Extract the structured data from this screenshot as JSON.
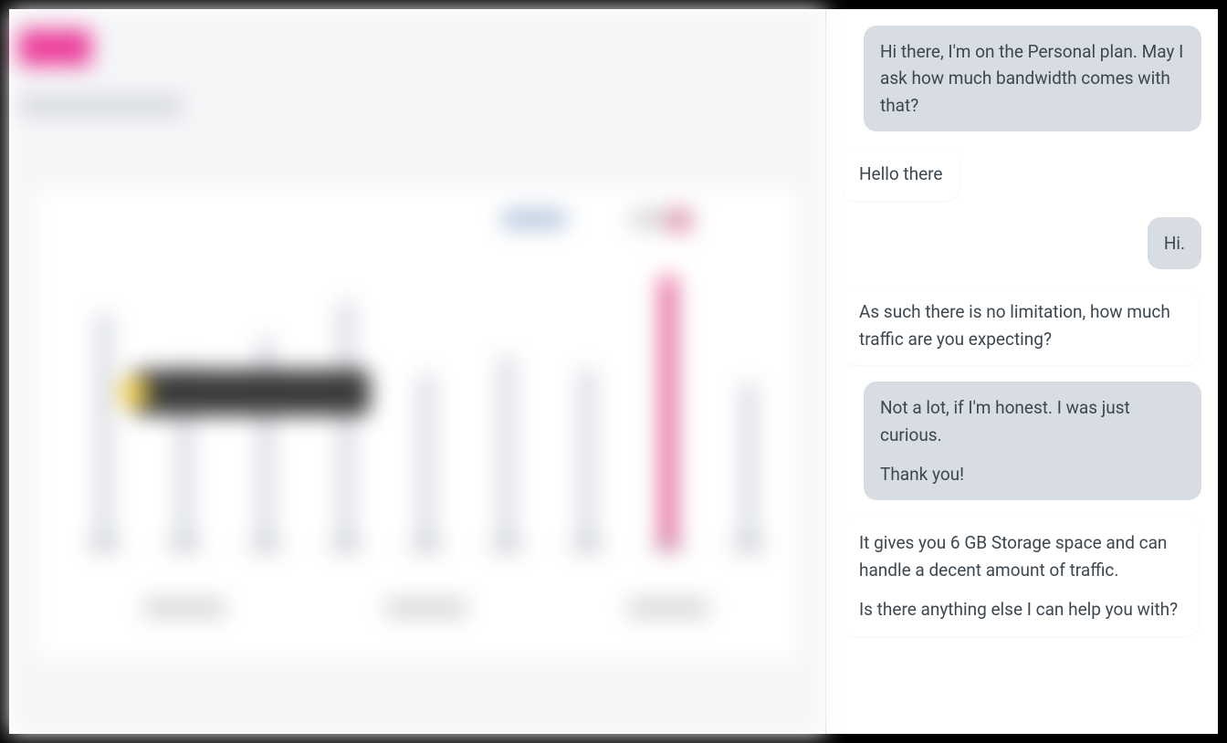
{
  "chat": {
    "messages": [
      {
        "role": "user",
        "paragraphs": [
          "Hi there, I'm on the Personal plan. May I ask how much bandwidth comes with that?"
        ]
      },
      {
        "role": "agent",
        "paragraphs": [
          "Hello there"
        ]
      },
      {
        "role": "user",
        "paragraphs": [
          "Hi."
        ]
      },
      {
        "role": "agent",
        "paragraphs": [
          "As such there is no limitation, how much traffic are you expecting?"
        ]
      },
      {
        "role": "user",
        "paragraphs": [
          "Not a lot, if I'm honest. I was just curious.",
          "Thank you!"
        ]
      },
      {
        "role": "agent",
        "paragraphs": [
          "It gives you 6 GB Storage space and can handle a decent amount of traffic.",
          "Is there anything else I can help you with?"
        ]
      }
    ]
  }
}
